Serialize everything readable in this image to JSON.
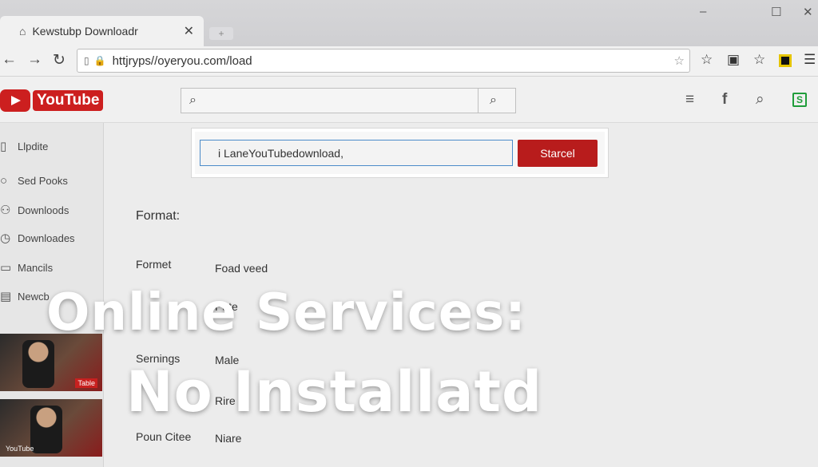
{
  "browser": {
    "tab_title": "Kewstubp Downloadr",
    "new_tab": "+",
    "url": "httjryps//oyeryou.com/load",
    "window_controls": [
      "–",
      "☐",
      "✕"
    ]
  },
  "toolbar_icons": [
    "star-icon",
    "bag-icon",
    "star-icon",
    "square-icon",
    "menu-icon"
  ],
  "youtube": {
    "logo_text": "YouTube",
    "search_placeholder": ""
  },
  "sidebar": {
    "items": [
      {
        "label": "Llpdite",
        "icon": "file-icon"
      },
      {
        "label": "Sed Pooks",
        "icon": "location-icon"
      },
      {
        "label": "Downloods",
        "icon": "people-icon"
      },
      {
        "label": "Downloades",
        "icon": "clock-icon"
      },
      {
        "label": "Mancils",
        "icon": "folder-icon"
      },
      {
        "label": "Newcb",
        "icon": "inbox-icon"
      }
    ],
    "thumbs": [
      "Table",
      "YouTube"
    ]
  },
  "form": {
    "input_value": "i LaneYouTubedownload,",
    "button_label": "Starcel"
  },
  "fields": {
    "format_title": "Format:",
    "rows": [
      {
        "label": "Formet",
        "value": "Foad veed"
      },
      {
        "label": "",
        "value": "Pate"
      },
      {
        "label": "Sernings",
        "value": "Male"
      },
      {
        "label": "",
        "value": "Rire"
      },
      {
        "label": "Poun Citee",
        "value": "Niare"
      }
    ]
  },
  "overlay": {
    "line1": "Online Services:",
    "line2": "No Installatd"
  }
}
